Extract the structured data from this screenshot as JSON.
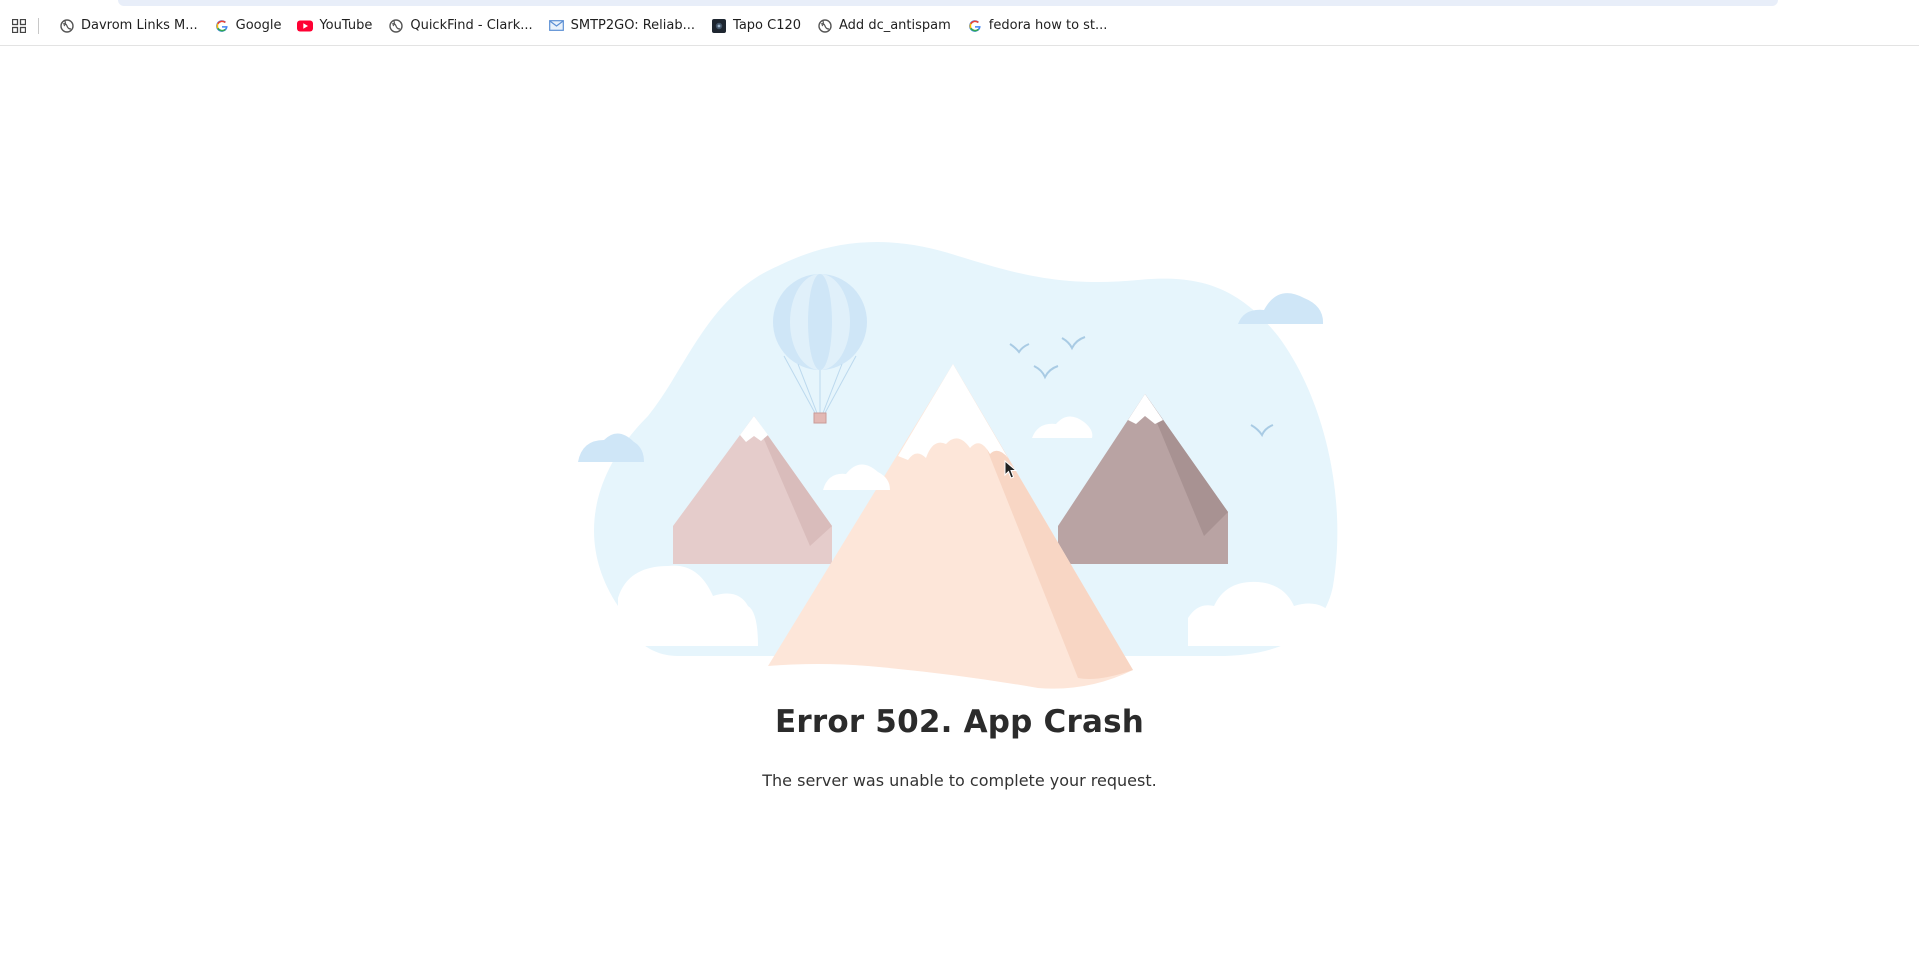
{
  "bookmarks": [
    {
      "label": "Davrom Links M...",
      "icon": "globe-icon"
    },
    {
      "label": "Google",
      "icon": "google-icon"
    },
    {
      "label": "YouTube",
      "icon": "youtube-icon"
    },
    {
      "label": "QuickFind - Clark...",
      "icon": "globe-icon"
    },
    {
      "label": "SMTP2GO: Reliab...",
      "icon": "mail-icon"
    },
    {
      "label": "Tapo C120",
      "icon": "camera-icon"
    },
    {
      "label": "Add dc_antispam",
      "icon": "globe-icon"
    },
    {
      "label": "fedora how to st...",
      "icon": "google-icon"
    }
  ],
  "error": {
    "title": "Error 502. App Crash",
    "message": "The server was unable to complete your request."
  },
  "colors": {
    "sky": "#e6f5fc",
    "cloud_blue": "#cfe6f7",
    "peach_mountain": "#fde6d9",
    "pink_mountain": "#e5cccb",
    "mauve_mountain": "#b9a3a3",
    "bird": "#a9cbe4"
  }
}
